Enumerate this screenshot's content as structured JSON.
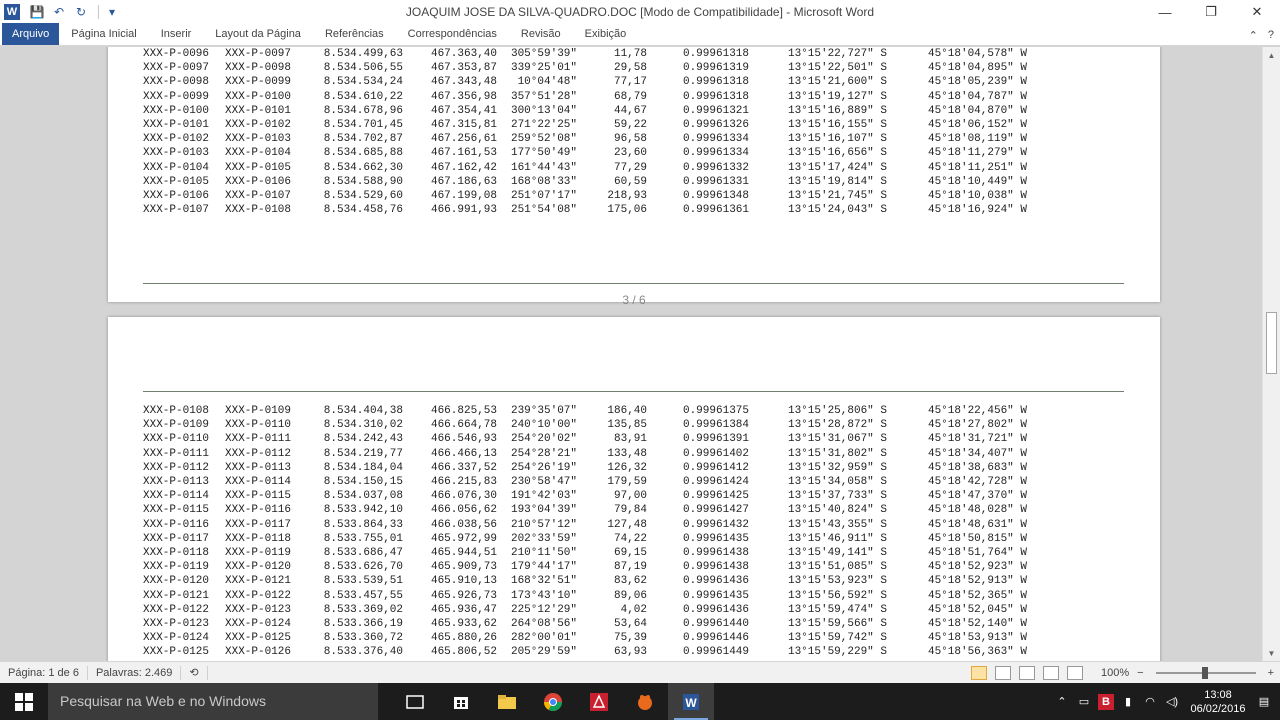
{
  "window": {
    "title": "JOAQUIM JOSE DA SILVA-QUADRO.DOC [Modo de Compatibilidade] - Microsoft Word",
    "app_icon_letter": "W",
    "controls": {
      "minimize": "—",
      "restore": "❐",
      "close": "✕"
    },
    "qat": {
      "save": "💾",
      "undo": "↶",
      "redo": "↻",
      "customize": "▾"
    }
  },
  "ribbon": {
    "tabs": [
      "Arquivo",
      "Página Inicial",
      "Inserir",
      "Layout da Página",
      "Referências",
      "Correspondências",
      "Revisão",
      "Exibição"
    ],
    "collapse": "⌃",
    "help": "?"
  },
  "document": {
    "page_counter": "3 / 6",
    "page_top_rows": [
      [
        "XXX-P-0096",
        "XXX-P-0097",
        "8.534.499,63",
        "467.363,40",
        "305°59'39\"",
        "11,78",
        "0.99961318",
        "13°15'22,727\" S",
        "45°18'04,578\" W"
      ],
      [
        "XXX-P-0097",
        "XXX-P-0098",
        "8.534.506,55",
        "467.353,87",
        "339°25'01\"",
        "29,58",
        "0.99961319",
        "13°15'22,501\" S",
        "45°18'04,895\" W"
      ],
      [
        "XXX-P-0098",
        "XXX-P-0099",
        "8.534.534,24",
        "467.343,48",
        "10°04'48\"",
        "77,17",
        "0.99961318",
        "13°15'21,600\" S",
        "45°18'05,239\" W"
      ],
      [
        "XXX-P-0099",
        "XXX-P-0100",
        "8.534.610,22",
        "467.356,98",
        "357°51'28\"",
        "68,79",
        "0.99961318",
        "13°15'19,127\" S",
        "45°18'04,787\" W"
      ],
      [
        "XXX-P-0100",
        "XXX-P-0101",
        "8.534.678,96",
        "467.354,41",
        "300°13'04\"",
        "44,67",
        "0.99961321",
        "13°15'16,889\" S",
        "45°18'04,870\" W"
      ],
      [
        "XXX-P-0101",
        "XXX-P-0102",
        "8.534.701,45",
        "467.315,81",
        "271°22'25\"",
        "59,22",
        "0.99961326",
        "13°15'16,155\" S",
        "45°18'06,152\" W"
      ],
      [
        "XXX-P-0102",
        "XXX-P-0103",
        "8.534.702,87",
        "467.256,61",
        "259°52'08\"",
        "96,58",
        "0.99961334",
        "13°15'16,107\" S",
        "45°18'08,119\" W"
      ],
      [
        "XXX-P-0103",
        "XXX-P-0104",
        "8.534.685,88",
        "467.161,53",
        "177°50'49\"",
        "23,60",
        "0.99961334",
        "13°15'16,656\" S",
        "45°18'11,279\" W"
      ],
      [
        "XXX-P-0104",
        "XXX-P-0105",
        "8.534.662,30",
        "467.162,42",
        "161°44'43\"",
        "77,29",
        "0.99961332",
        "13°15'17,424\" S",
        "45°18'11,251\" W"
      ],
      [
        "XXX-P-0105",
        "XXX-P-0106",
        "8.534.588,90",
        "467.186,63",
        "168°08'33\"",
        "60,59",
        "0.99961331",
        "13°15'19,814\" S",
        "45°18'10,449\" W"
      ],
      [
        "XXX-P-0106",
        "XXX-P-0107",
        "8.534.529,60",
        "467.199,08",
        "251°07'17\"",
        "218,93",
        "0.99961348",
        "13°15'21,745\" S",
        "45°18'10,038\" W"
      ],
      [
        "XXX-P-0107",
        "XXX-P-0108",
        "8.534.458,76",
        "466.991,93",
        "251°54'08\"",
        "175,06",
        "0.99961361",
        "13°15'24,043\" S",
        "45°18'16,924\" W"
      ]
    ],
    "page_bottom_rows": [
      [
        "XXX-P-0108",
        "XXX-P-0109",
        "8.534.404,38",
        "466.825,53",
        "239°35'07\"",
        "186,40",
        "0.99961375",
        "13°15'25,806\" S",
        "45°18'22,456\" W"
      ],
      [
        "XXX-P-0109",
        "XXX-P-0110",
        "8.534.310,02",
        "466.664,78",
        "240°10'00\"",
        "135,85",
        "0.99961384",
        "13°15'28,872\" S",
        "45°18'27,802\" W"
      ],
      [
        "XXX-P-0110",
        "XXX-P-0111",
        "8.534.242,43",
        "466.546,93",
        "254°20'02\"",
        "83,91",
        "0.99961391",
        "13°15'31,067\" S",
        "45°18'31,721\" W"
      ],
      [
        "XXX-P-0111",
        "XXX-P-0112",
        "8.534.219,77",
        "466.466,13",
        "254°28'21\"",
        "133,48",
        "0.99961402",
        "13°15'31,802\" S",
        "45°18'34,407\" W"
      ],
      [
        "XXX-P-0112",
        "XXX-P-0113",
        "8.534.184,04",
        "466.337,52",
        "254°26'19\"",
        "126,32",
        "0.99961412",
        "13°15'32,959\" S",
        "45°18'38,683\" W"
      ],
      [
        "XXX-P-0113",
        "XXX-P-0114",
        "8.534.150,15",
        "466.215,83",
        "230°58'47\"",
        "179,59",
        "0.99961424",
        "13°15'34,058\" S",
        "45°18'42,728\" W"
      ],
      [
        "XXX-P-0114",
        "XXX-P-0115",
        "8.534.037,08",
        "466.076,30",
        "191°42'03\"",
        "97,00",
        "0.99961425",
        "13°15'37,733\" S",
        "45°18'47,370\" W"
      ],
      [
        "XXX-P-0115",
        "XXX-P-0116",
        "8.533.942,10",
        "466.056,62",
        "193°04'39\"",
        "79,84",
        "0.99961427",
        "13°15'40,824\" S",
        "45°18'48,028\" W"
      ],
      [
        "XXX-P-0116",
        "XXX-P-0117",
        "8.533.864,33",
        "466.038,56",
        "210°57'12\"",
        "127,48",
        "0.99961432",
        "13°15'43,355\" S",
        "45°18'48,631\" W"
      ],
      [
        "XXX-P-0117",
        "XXX-P-0118",
        "8.533.755,01",
        "465.972,99",
        "202°33'59\"",
        "74,22",
        "0.99961435",
        "13°15'46,911\" S",
        "45°18'50,815\" W"
      ],
      [
        "XXX-P-0118",
        "XXX-P-0119",
        "8.533.686,47",
        "465.944,51",
        "210°11'50\"",
        "69,15",
        "0.99961438",
        "13°15'49,141\" S",
        "45°18'51,764\" W"
      ],
      [
        "XXX-P-0119",
        "XXX-P-0120",
        "8.533.626,70",
        "465.909,73",
        "179°44'17\"",
        "87,19",
        "0.99961438",
        "13°15'51,085\" S",
        "45°18'52,923\" W"
      ],
      [
        "XXX-P-0120",
        "XXX-P-0121",
        "8.533.539,51",
        "465.910,13",
        "168°32'51\"",
        "83,62",
        "0.99961436",
        "13°15'53,923\" S",
        "45°18'52,913\" W"
      ],
      [
        "XXX-P-0121",
        "XXX-P-0122",
        "8.533.457,55",
        "465.926,73",
        "173°43'10\"",
        "89,06",
        "0.99961435",
        "13°15'56,592\" S",
        "45°18'52,365\" W"
      ],
      [
        "XXX-P-0122",
        "XXX-P-0123",
        "8.533.369,02",
        "465.936,47",
        "225°12'29\"",
        "4,02",
        "0.99961436",
        "13°15'59,474\" S",
        "45°18'52,045\" W"
      ],
      [
        "XXX-P-0123",
        "XXX-P-0124",
        "8.533.366,19",
        "465.933,62",
        "264°08'56\"",
        "53,64",
        "0.99961440",
        "13°15'59,566\" S",
        "45°18'52,140\" W"
      ],
      [
        "XXX-P-0124",
        "XXX-P-0125",
        "8.533.360,72",
        "465.880,26",
        "282°00'01\"",
        "75,39",
        "0.99961446",
        "13°15'59,742\" S",
        "45°18'53,913\" W"
      ],
      [
        "XXX-P-0125",
        "XXX-P-0126",
        "8.533.376,40",
        "465.806,52",
        "205°29'59\"",
        "63,93",
        "0.99961449",
        "13°15'59,229\" S",
        "45°18'56,363\" W"
      ]
    ]
  },
  "status": {
    "page": "Página: 1 de 6",
    "words": "Palavras: 2.469",
    "zoom": "100%",
    "zoom_minus": "−",
    "zoom_plus": "+"
  },
  "scrollbar": {
    "up": "▲",
    "down": "▼"
  },
  "taskbar": {
    "search_placeholder": "Pesquisar na Web e no Windows",
    "time": "13:08",
    "date": "06/02/2016",
    "accent": "#2b579a"
  }
}
